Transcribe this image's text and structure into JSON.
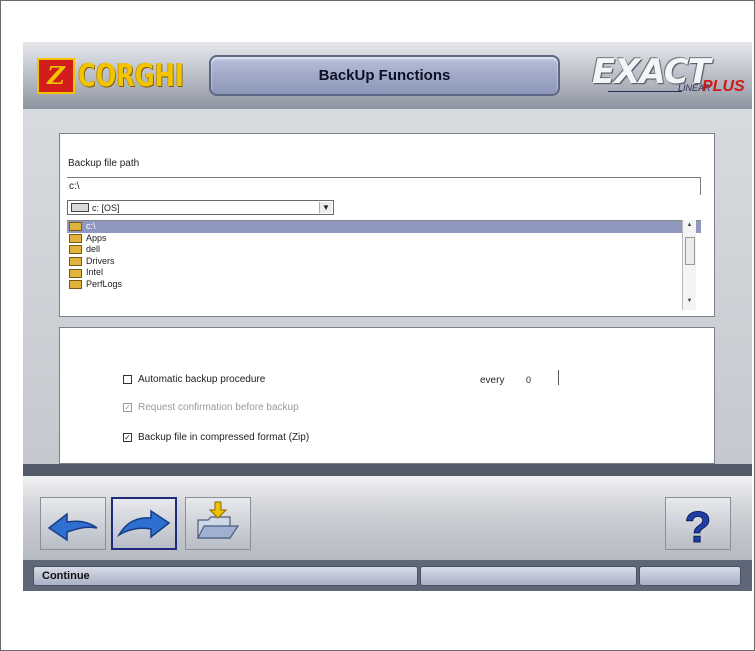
{
  "header": {
    "logo_text": "CORGHI",
    "title": "BackUp Functions",
    "brand_exact": "EXACT",
    "brand_linear": "LINEAR",
    "brand_plus": "PLUS"
  },
  "backup_path": {
    "label": "Backup file path",
    "value": "c:\\",
    "drive": "c: [OS]",
    "folders": [
      "c:\\",
      "Apps",
      "dell",
      "Drivers",
      "Intel",
      "PerfLogs"
    ],
    "selected_folder": "c:\\"
  },
  "options": {
    "automatic": {
      "label": "Automatic backup procedure",
      "checked": false
    },
    "every_label": "every",
    "every_value": "0",
    "confirmation": {
      "label": "Request confirmation before backup",
      "checked": true,
      "enabled": false
    },
    "compressed": {
      "label": "Backup file in compressed format (Zip)",
      "checked": true
    }
  },
  "toolbar": {
    "back": "arrow-left-icon",
    "next": "arrow-right-icon",
    "folder": "folder-download-icon",
    "help": "question-mark-icon"
  },
  "status": {
    "text": "Continue"
  },
  "colors": {
    "accent_yellow": "#f2c400",
    "brand_red": "#d31c1c",
    "selection": "#8f99c0"
  }
}
